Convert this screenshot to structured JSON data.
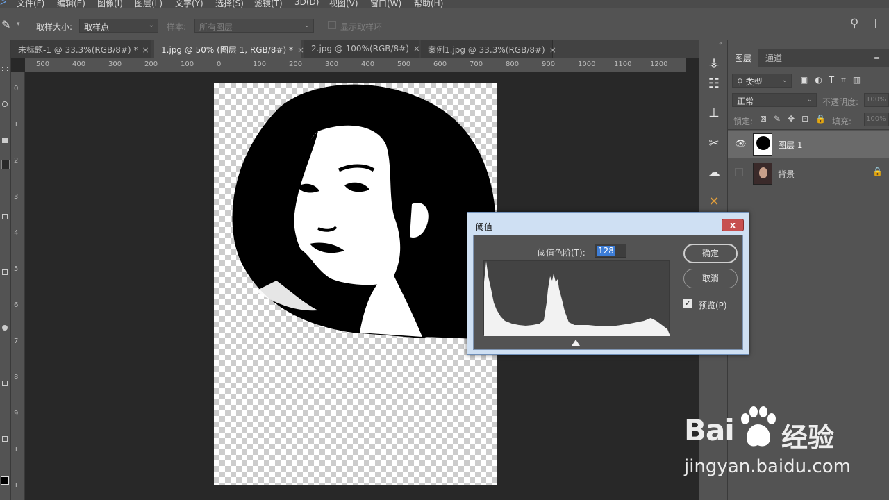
{
  "menubar": {
    "items": [
      "文件(F)",
      "编辑(E)",
      "图像(I)",
      "图层(L)",
      "文字(Y)",
      "选择(S)",
      "滤镜(T)",
      "3D(D)",
      "视图(V)",
      "窗口(W)",
      "帮助(H)"
    ]
  },
  "options": {
    "sample_size_label": "取样大小:",
    "sample_size_value": "取样点",
    "sample_label": "样本:",
    "sample_value": "所有图层",
    "show_ring_label": "显示取样环"
  },
  "tabs": [
    {
      "label": "未标题-1 @ 33.3%(RGB/8#) *"
    },
    {
      "label": "1.jpg @ 50% (图层 1, RGB/8#) *"
    },
    {
      "label": "2.jpg @ 100%(RGB/8#)"
    },
    {
      "label": "案例1.jpg @ 33.3%(RGB/8#)"
    }
  ],
  "ruler_top": [
    "500",
    "400",
    "300",
    "200",
    "100",
    "0",
    "100",
    "200",
    "300",
    "400",
    "500",
    "600",
    "700",
    "800",
    "900",
    "1000",
    "1100",
    "1200"
  ],
  "ruler_left": [
    "0",
    "1",
    "2",
    "3",
    "4",
    "5",
    "6",
    "7",
    "8",
    "9",
    "1",
    "1"
  ],
  "layers_panel": {
    "tabs": [
      "图层",
      "通道"
    ],
    "filter_placeholder": "类型",
    "blend_mode": "正常",
    "opacity_label": "不透明度:",
    "opacity_value": "100%",
    "lock_label": "锁定:",
    "fill_label": "填充:",
    "fill_value": "100%",
    "layers": [
      {
        "name": "图层 1",
        "visible": true,
        "selected": true
      },
      {
        "name": "背景",
        "visible": false,
        "locked": true
      }
    ]
  },
  "threshold_dialog": {
    "title": "阈值",
    "level_label": "阈值色阶(T):",
    "level_value": "128",
    "ok_label": "确定",
    "cancel_label": "取消",
    "preview_label": "预览(P)",
    "preview_checked": true,
    "close_label": "x"
  },
  "watermark": {
    "brand": "Bai",
    "brand_cn": "经验",
    "url": "jingyan.baidu.com"
  },
  "colors": {
    "panel_bg": "#535353",
    "canvas_bg": "#282828",
    "dialog_frame": "#cfe0f3",
    "selection_blue": "#3d7dd6"
  }
}
